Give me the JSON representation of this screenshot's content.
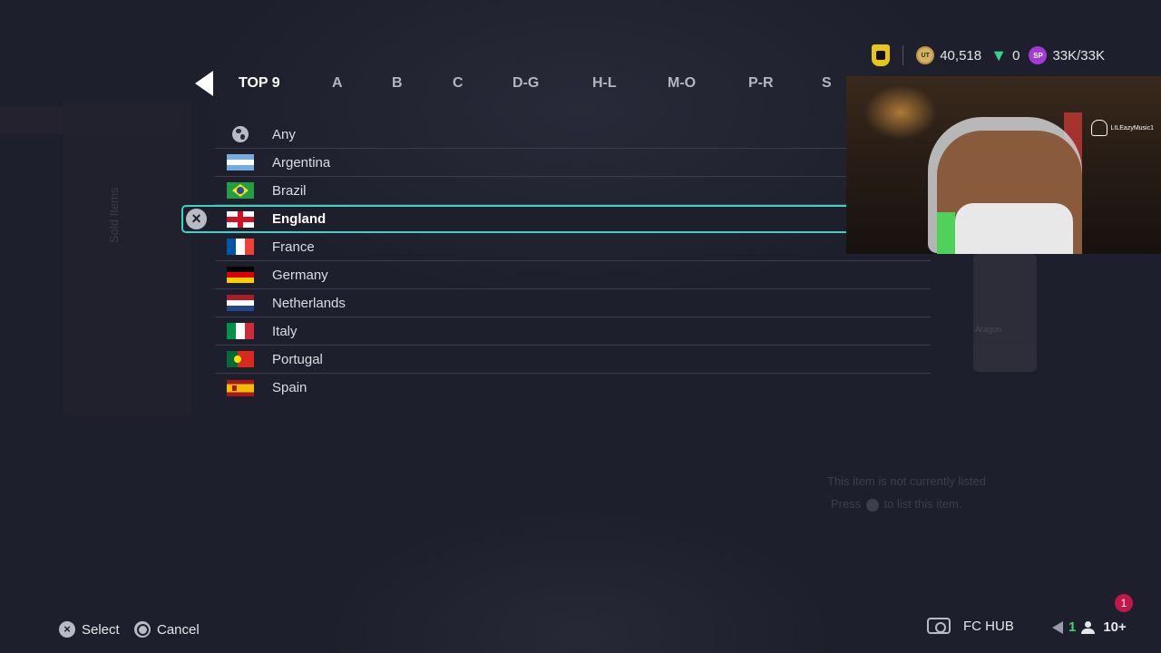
{
  "topbar": {
    "coins": "40,518",
    "points": "0",
    "sp": "33K/33K",
    "coin_label": "UT",
    "sp_label": "SP"
  },
  "tabs": [
    "TOP 9",
    "A",
    "B",
    "C",
    "D-G",
    "H-L",
    "M-O",
    "P-R",
    "S"
  ],
  "active_tab": "TOP 9",
  "nations": [
    {
      "label": "Any",
      "icon": "globe-icon"
    },
    {
      "label": "Argentina",
      "flag": "argentina-flag"
    },
    {
      "label": "Brazil",
      "flag": "brazil-flag"
    },
    {
      "label": "England",
      "flag": "england-flag",
      "selected": true
    },
    {
      "label": "France",
      "flag": "france-flag"
    },
    {
      "label": "Germany",
      "flag": "germany-flag"
    },
    {
      "label": "Netherlands",
      "flag": "netherlands-flag"
    },
    {
      "label": "Italy",
      "flag": "italy-flag"
    },
    {
      "label": "Portugal",
      "flag": "portugal-flag"
    },
    {
      "label": "Spain",
      "flag": "spain-flag"
    }
  ],
  "webcam": {
    "handle": "LILEazyMusic1"
  },
  "background_text": {
    "side_label": "Sold Items",
    "status_line1": "This item is not currently listed",
    "status_line2_pre": "Press",
    "status_line2_post": "to list this item.",
    "card_name": "Aragon"
  },
  "bottom": {
    "select_label": "Select",
    "cancel_label": "Cancel",
    "hub_label": "FC HUB",
    "notifications": "1",
    "voice_count": "1",
    "friends_count": "10+"
  },
  "colors": {
    "background": "#1e1f2c",
    "selection_outline": "#3ed1c8",
    "coin": "#d4b262",
    "points": "#2fd68a",
    "sp": "#a33ad6",
    "notification": "#c4164a"
  }
}
